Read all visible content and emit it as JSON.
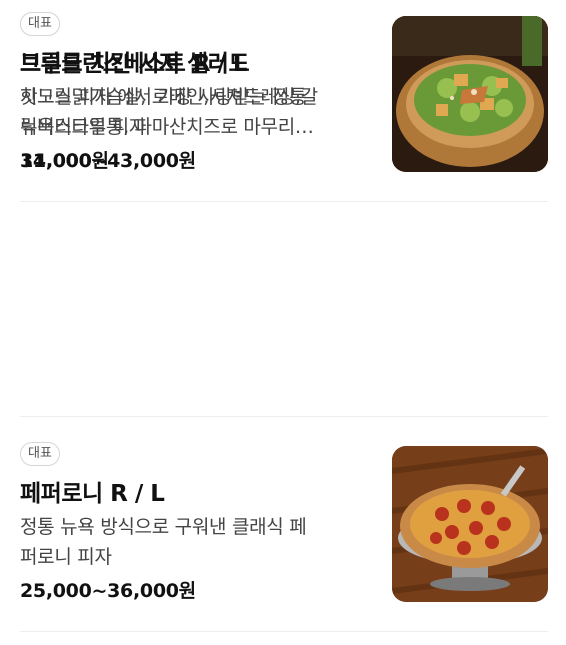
{
  "items": [
    {
      "badge": "대표",
      "title": "브루클린스베스트 R / L",
      "desc_lines": [
        "지노스 피자 에서 가장 사랑받는 정통",
        "뉴욕스타일 피자"
      ],
      "price": "31,000~43,000원"
    },
    {
      "badge": "대표",
      "title": "페퍼로니 R / L",
      "desc_lines": [
        "정통 뉴욕 방식으로 구워낸 클래식 페",
        "퍼로니 피자"
      ],
      "price": "25,000~36,000원"
    },
    {
      "badge": "대표",
      "title": "그릴드 치킨 시저 셀러드",
      "desc_lines": [
        "핫그릴닭가슴살, 로메인,시져드레싱,갈",
        "릭버터크루통, 파마산치즈로 마무리…"
      ],
      "price": "14,000원"
    }
  ],
  "icons": [
    "pizza-photo",
    "pepperoni-pizza-photo",
    "chicken-caesar-salad-photo"
  ]
}
